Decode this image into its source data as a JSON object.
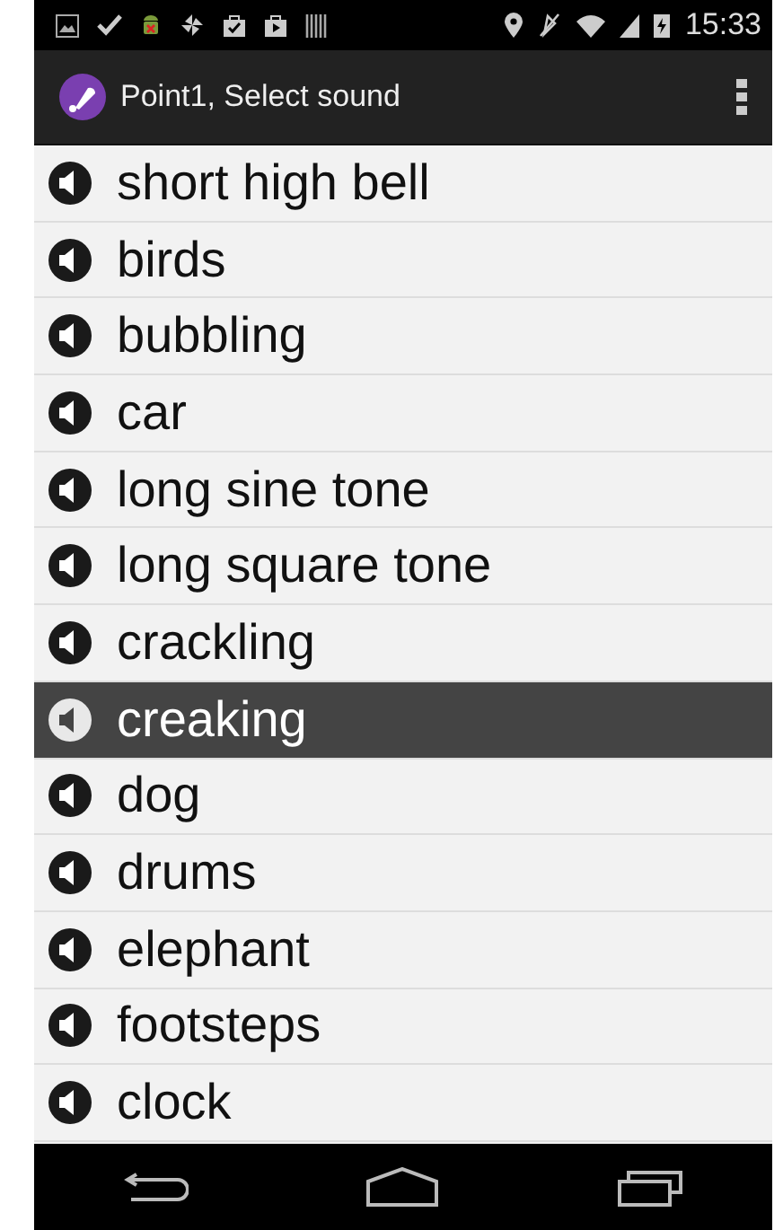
{
  "status_bar": {
    "time": "15:33"
  },
  "action_bar": {
    "title": "Point1, Select sound"
  },
  "sounds": [
    {
      "label": "short high bell",
      "selected": false
    },
    {
      "label": "birds",
      "selected": false
    },
    {
      "label": "bubbling",
      "selected": false
    },
    {
      "label": "car",
      "selected": false
    },
    {
      "label": "long sine tone",
      "selected": false
    },
    {
      "label": "long square tone",
      "selected": false
    },
    {
      "label": "crackling",
      "selected": false
    },
    {
      "label": "creaking",
      "selected": true
    },
    {
      "label": "dog",
      "selected": false
    },
    {
      "label": "drums",
      "selected": false
    },
    {
      "label": "elephant",
      "selected": false
    },
    {
      "label": "footsteps",
      "selected": false
    },
    {
      "label": "clock",
      "selected": false
    }
  ]
}
